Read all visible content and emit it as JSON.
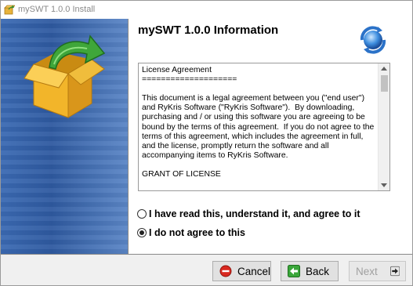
{
  "window": {
    "title": "mySWT 1.0.0 Install"
  },
  "main": {
    "heading": "mySWT 1.0.0 Information"
  },
  "license": {
    "text": "License Agreement\n====================\n\nThis document is a legal agreement between you (\"end user\") and RyKris Software (\"RyKris Software\").  By downloading, purchasing and / or using this software you are agreeing to be bound by the terms of this agreement.  If you do not agree to the terms of this agreement, which includes the agreement in full, and the license, promptly return the software and all accompanying items to RyKris Software.\n\nGRANT OF LICENSE"
  },
  "options": {
    "agree": {
      "label": "I have read this, understand it, and agree to it",
      "checked": false
    },
    "disagree": {
      "label": "I do not agree to this",
      "checked": true
    }
  },
  "buttons": {
    "cancel": {
      "label": "Cancel",
      "icon": "stop-icon"
    },
    "back": {
      "label": "Back",
      "icon": "back-arrow-icon"
    },
    "next": {
      "label": "Next",
      "icon": "next-arrow-icon",
      "enabled": false
    }
  }
}
